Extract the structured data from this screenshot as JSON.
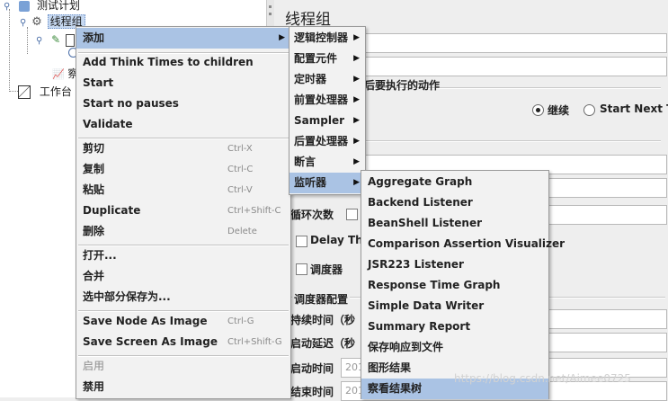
{
  "tree": {
    "test_plan": "测试计划",
    "thread_group": "线程组",
    "node_partial": "察",
    "workbench": "工作台"
  },
  "panel": {
    "title": "线程组",
    "action_section_fragment": "后要执行的动作",
    "radio_continue": "继续",
    "radio_start_next": "Start Next Thr",
    "loop_label": "循环次数",
    "delay_label": "Delay Thre",
    "scheduler_label": "调度器",
    "scheduler_config": "调度器配置",
    "duration": "持续时间（秒",
    "startup_delay": "启动延迟（秒",
    "start_time": "启动时间",
    "end_time": "结束时间",
    "start_time_value": "201",
    "end_time_value": "201"
  },
  "context_menu": {
    "add": "添加",
    "add_think_times": "Add Think Times to children",
    "start": "Start",
    "start_no_pauses": "Start no pauses",
    "validate": "Validate",
    "cut": "剪切",
    "cut_sc": "Ctrl-X",
    "copy": "复制",
    "copy_sc": "Ctrl-C",
    "paste": "粘贴",
    "paste_sc": "Ctrl-V",
    "duplicate": "Duplicate",
    "duplicate_sc": "Ctrl+Shift-C",
    "delete": "删除",
    "delete_sc": "Delete",
    "open": "打开...",
    "merge": "合并",
    "save_selection": "选中部分保存为...",
    "save_node_image": "Save Node As Image",
    "save_node_image_sc": "Ctrl-G",
    "save_screen_image": "Save Screen As Image",
    "save_screen_image_sc": "Ctrl+Shift-G",
    "enable": "启用",
    "disable": "禁用"
  },
  "add_submenu": {
    "logic_controller": "逻辑控制器",
    "config_element": "配置元件",
    "timer": "定时器",
    "pre_processor": "前置处理器",
    "sampler": "Sampler",
    "post_processor": "后置处理器",
    "assertion": "断言",
    "listener": "监听器"
  },
  "listener_submenu": {
    "items": [
      "Aggregate Graph",
      "Backend Listener",
      "BeanShell Listener",
      "Comparison Assertion Visualizer",
      "JSR223 Listener",
      "Response Time Graph",
      "Simple Data Writer",
      "Summary Report",
      "保存响应到文件",
      "图形结果",
      "察看结果树"
    ]
  },
  "watermark": "https://blog.csdn.net/Aimee0725",
  "colors": {
    "highlight": "#aac3e4",
    "tree_select": "#c7d9f1",
    "menu_bg": "#f2f2f2"
  }
}
